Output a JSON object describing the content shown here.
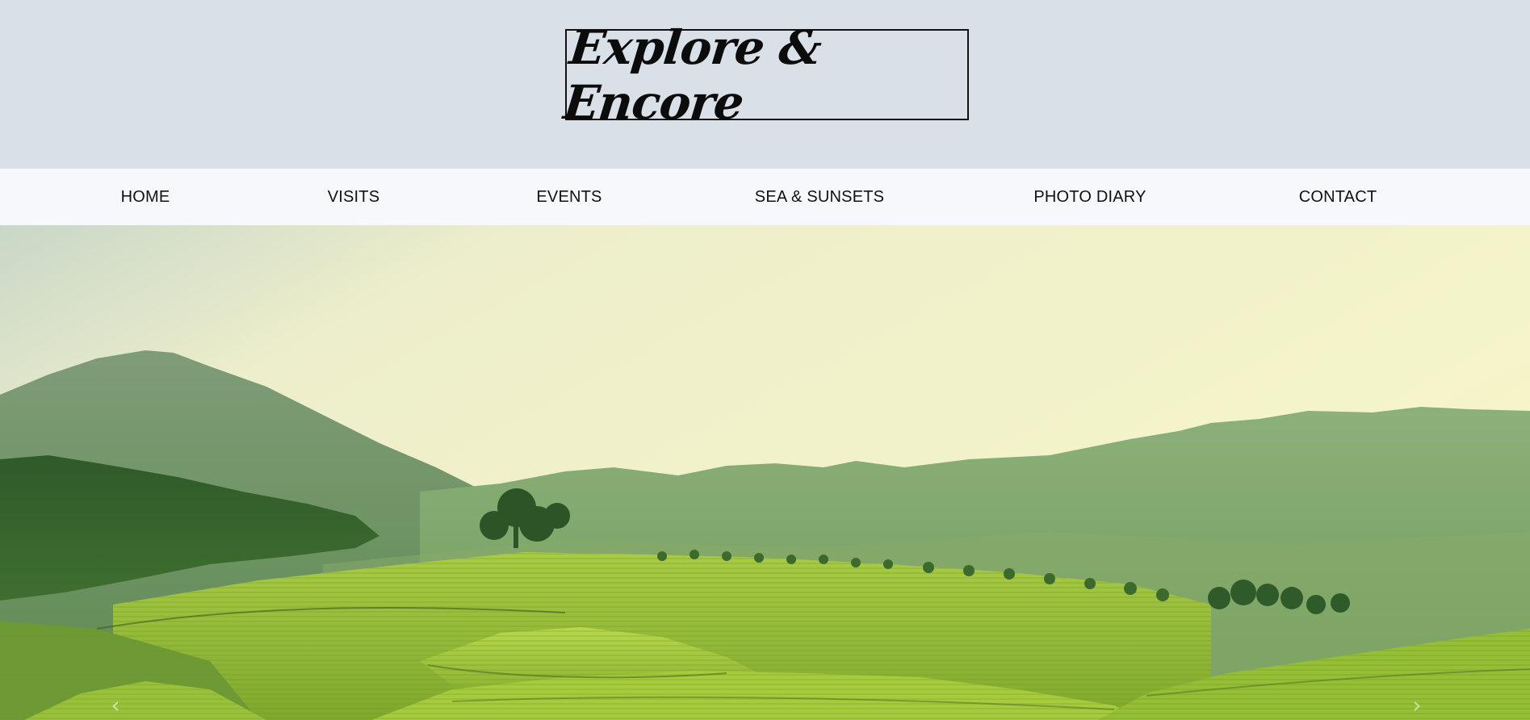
{
  "header": {
    "logo_text": "Explore & Encore"
  },
  "nav": {
    "items": [
      {
        "label": "HOME"
      },
      {
        "label": "VISITS"
      },
      {
        "label": "EVENTS"
      },
      {
        "label": "SEA & SUNSETS"
      },
      {
        "label": "PHOTO DIARY"
      },
      {
        "label": "CONTACT"
      }
    ]
  },
  "hero": {
    "image_icon": "landscape-photo",
    "prev_icon": "chevron-left-icon",
    "next_icon": "chevron-right-icon"
  },
  "colors": {
    "header_bg": "#dae0e8",
    "nav_bg": "#f7f8fb",
    "text": "#111111",
    "sky": "#f5f4c8",
    "hills": "#6f9a55",
    "tea_fields": "#9cc43a"
  }
}
